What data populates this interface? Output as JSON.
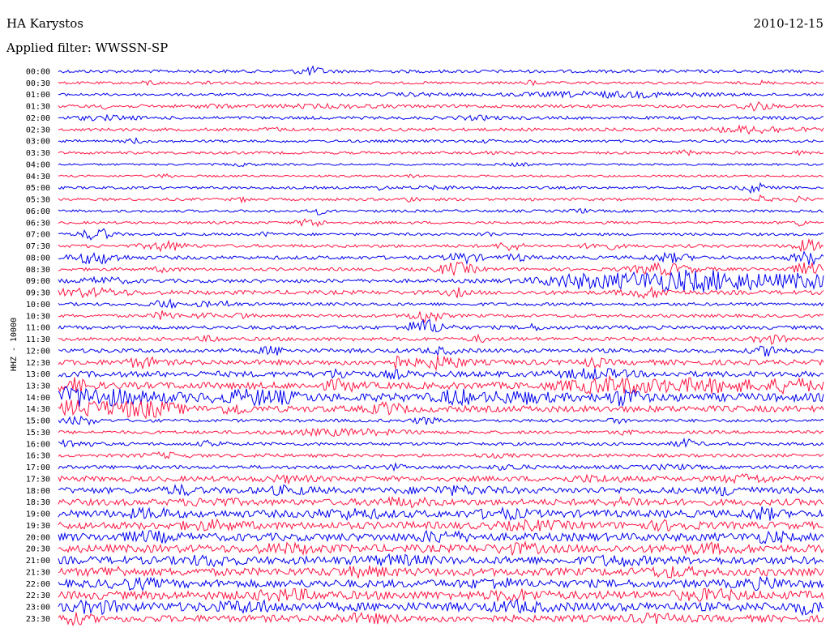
{
  "header": {
    "station": "HA Karystos",
    "date": "2010-12-15",
    "filter": "Applied filter: WWSSN-SP"
  },
  "channel_label": "HHZ - 10000",
  "colors": {
    "odd_trace": "#0000ee",
    "even_trace": "#ff1744"
  },
  "chart_data": {
    "type": "line",
    "title": "HA Karystos",
    "subtitle": "Applied filter: WWSSN-SP",
    "date": "2010-12-15",
    "ylabel": "HHZ - 10000",
    "xlabel": "",
    "grid": false,
    "trace_colors": [
      "#0000ee",
      "#ff1744"
    ],
    "rows": [
      {
        "label": "00:00",
        "base": 0.6,
        "events": [
          [
            0.33,
            1.4,
            1.8
          ]
        ]
      },
      {
        "label": "00:30",
        "base": 0.5,
        "events": [
          [
            0.12,
            0.8,
            1.0
          ],
          [
            0.2,
            1.0,
            0.9
          ],
          [
            0.62,
            0.8,
            1.0
          ],
          [
            0.92,
            0.6,
            1.0
          ]
        ]
      },
      {
        "label": "01:00",
        "base": 0.5,
        "events": [
          [
            0.72,
            0.9,
            12.0
          ],
          [
            0.47,
            0.4,
            4.0
          ]
        ]
      },
      {
        "label": "01:30",
        "base": 0.6,
        "events": [
          [
            0.06,
            0.6,
            1.0
          ],
          [
            0.2,
            0.5,
            2.0
          ],
          [
            0.35,
            0.4,
            8.0
          ],
          [
            0.91,
            1.6,
            2.0
          ]
        ]
      },
      {
        "label": "02:00",
        "base": 0.6,
        "events": [
          [
            0.06,
            0.6,
            4.0
          ],
          [
            0.55,
            0.5,
            3.0
          ]
        ]
      },
      {
        "label": "02:30",
        "base": 0.6,
        "events": [
          [
            0.28,
            0.6,
            1.0
          ],
          [
            0.91,
            1.2,
            5.0
          ]
        ]
      },
      {
        "label": "03:00",
        "base": 0.5,
        "events": [
          [
            0.1,
            1.0,
            1.0
          ],
          [
            0.56,
            0.4,
            1.0
          ]
        ]
      },
      {
        "label": "03:30",
        "base": 0.5,
        "events": [
          [
            0.56,
            0.6,
            1.0
          ],
          [
            0.82,
            0.8,
            1.0
          ],
          [
            0.97,
            0.5,
            1.0
          ]
        ]
      },
      {
        "label": "04:00",
        "base": 0.4,
        "events": [
          [
            0.24,
            0.4,
            2.0
          ],
          [
            0.6,
            0.4,
            2.0
          ]
        ]
      },
      {
        "label": "04:30",
        "base": 0.4,
        "events": [
          [
            0.14,
            0.6,
            1.0
          ],
          [
            0.46,
            0.4,
            1.0
          ]
        ]
      },
      {
        "label": "05:00",
        "base": 0.5,
        "events": [
          [
            0.42,
            0.6,
            1.0
          ],
          [
            0.5,
            0.4,
            4.0
          ],
          [
            0.91,
            1.8,
            1.5
          ]
        ]
      },
      {
        "label": "05:30",
        "base": 0.5,
        "events": [
          [
            0.24,
            0.6,
            1.0
          ],
          [
            0.46,
            0.8,
            1.0
          ],
          [
            0.92,
            1.2,
            1.0
          ],
          [
            0.97,
            0.8,
            1.0
          ]
        ]
      },
      {
        "label": "06:00",
        "base": 0.5,
        "events": [
          [
            0.34,
            1.0,
            1.0
          ],
          [
            0.68,
            0.8,
            1.0
          ]
        ]
      },
      {
        "label": "06:30",
        "base": 0.5,
        "events": [
          [
            0.33,
            1.6,
            1.5
          ],
          [
            0.97,
            1.0,
            1.0
          ]
        ]
      },
      {
        "label": "07:00",
        "base": 0.5,
        "events": [
          [
            0.05,
            2.2,
            2.0
          ],
          [
            0.27,
            0.6,
            1.0
          ],
          [
            0.56,
            0.8,
            1.0
          ]
        ]
      },
      {
        "label": "07:30",
        "base": 0.6,
        "events": [
          [
            0.14,
            1.6,
            2.5
          ],
          [
            0.59,
            1.6,
            1.5
          ],
          [
            0.71,
            1.4,
            2.0
          ],
          [
            0.98,
            2.0,
            2.0
          ]
        ]
      },
      {
        "label": "08:00",
        "base": 0.7,
        "events": [
          [
            0.05,
            2.0,
            3.0
          ],
          [
            0.53,
            1.8,
            2.0
          ],
          [
            0.6,
            1.0,
            1.5
          ],
          [
            0.8,
            1.4,
            2.5
          ],
          [
            0.98,
            2.2,
            2.0
          ]
        ]
      },
      {
        "label": "08:30",
        "base": 0.6,
        "events": [
          [
            0.14,
            0.8,
            1.5
          ],
          [
            0.52,
            2.2,
            2.5
          ],
          [
            0.79,
            2.0,
            4.0
          ],
          [
            0.98,
            2.2,
            2.0
          ]
        ]
      },
      {
        "label": "09:00",
        "base": 0.7,
        "events": [
          [
            0.06,
            1.0,
            3.0
          ],
          [
            0.67,
            1.2,
            4.0
          ],
          [
            0.78,
            2.6,
            12.0
          ],
          [
            0.88,
            2.0,
            10.0
          ],
          [
            0.98,
            1.6,
            3.0
          ]
        ]
      },
      {
        "label": "09:30",
        "base": 0.8,
        "events": [
          [
            0.04,
            1.2,
            5.0
          ],
          [
            0.52,
            1.4,
            1.0
          ],
          [
            0.77,
            1.6,
            3.0
          ]
        ]
      },
      {
        "label": "10:00",
        "base": 0.6,
        "events": [
          [
            0.14,
            1.6,
            1.5
          ],
          [
            0.19,
            0.8,
            1.0
          ],
          [
            0.22,
            1.0,
            1.0
          ]
        ]
      },
      {
        "label": "10:30",
        "base": 0.6,
        "events": [
          [
            0.14,
            1.6,
            1.5
          ],
          [
            0.19,
            0.8,
            1.5
          ],
          [
            0.24,
            1.2,
            1.0
          ],
          [
            0.48,
            2.2,
            2.0
          ]
        ]
      },
      {
        "label": "11:00",
        "base": 0.7,
        "events": [
          [
            0.48,
            2.6,
            2.5
          ],
          [
            0.62,
            0.8,
            1.5
          ]
        ]
      },
      {
        "label": "11:30",
        "base": 0.7,
        "events": [
          [
            0.2,
            0.8,
            1.5
          ],
          [
            0.55,
            1.0,
            1.0
          ],
          [
            0.93,
            1.4,
            2.0
          ]
        ]
      },
      {
        "label": "12:00",
        "base": 0.8,
        "events": [
          [
            0.28,
            1.4,
            1.5
          ],
          [
            0.5,
            1.0,
            2.0
          ],
          [
            0.93,
            1.6,
            2.0
          ]
        ]
      },
      {
        "label": "12:30",
        "base": 1.0,
        "events": [
          [
            0.11,
            1.6,
            2.0
          ],
          [
            0.44,
            2.0,
            1.5
          ],
          [
            0.5,
            2.0,
            3.0
          ],
          [
            0.7,
            1.2,
            1.5
          ]
        ]
      },
      {
        "label": "13:00",
        "base": 1.1,
        "events": [
          [
            0.37,
            1.2,
            2.0
          ],
          [
            0.44,
            1.0,
            1.5
          ],
          [
            0.7,
            1.4,
            4.0
          ]
        ]
      },
      {
        "label": "13:30",
        "base": 1.3,
        "events": [
          [
            0.02,
            2.0,
            2.0
          ],
          [
            0.37,
            1.6,
            2.0
          ],
          [
            0.72,
            2.2,
            6.0
          ],
          [
            0.85,
            1.8,
            8.0
          ],
          [
            0.96,
            1.8,
            3.0
          ]
        ]
      },
      {
        "label": "14:00",
        "base": 1.6,
        "events": [
          [
            0.02,
            2.6,
            10.0
          ],
          [
            0.26,
            2.0,
            5.0
          ],
          [
            0.52,
            2.2,
            2.0
          ],
          [
            0.74,
            2.4,
            2.0
          ],
          [
            0.6,
            1.4,
            4.0
          ]
        ]
      },
      {
        "label": "14:30",
        "base": 1.2,
        "events": [
          [
            0.02,
            2.4,
            8.0
          ],
          [
            0.12,
            2.0,
            4.0
          ],
          [
            0.23,
            1.8,
            1.5
          ],
          [
            0.43,
            1.8,
            2.0
          ]
        ]
      },
      {
        "label": "15:00",
        "base": 0.6,
        "events": [
          [
            0.03,
            1.4,
            2.0
          ],
          [
            0.48,
            1.2,
            1.5
          ],
          [
            0.73,
            0.8,
            1.0
          ]
        ]
      },
      {
        "label": "15:30",
        "base": 0.6,
        "events": [
          [
            0.37,
            1.0,
            8.0
          ],
          [
            0.74,
            0.8,
            1.0
          ]
        ]
      },
      {
        "label": "16:00",
        "base": 0.6,
        "events": [
          [
            0.02,
            1.4,
            2.0
          ],
          [
            0.2,
            1.0,
            1.5
          ],
          [
            0.82,
            1.4,
            1.5
          ]
        ]
      },
      {
        "label": "16:30",
        "base": 0.6,
        "events": [
          [
            0.14,
            0.8,
            3.0
          ],
          [
            0.27,
            0.6,
            1.0
          ],
          [
            0.57,
            0.4,
            3.0
          ]
        ]
      },
      {
        "label": "17:00",
        "base": 0.7,
        "events": [
          [
            0.44,
            0.8,
            1.0
          ],
          [
            0.59,
            0.8,
            2.0
          ],
          [
            0.8,
            0.6,
            3.0
          ]
        ]
      },
      {
        "label": "17:30",
        "base": 1.0,
        "events": [
          [
            0.3,
            0.8,
            3.0
          ],
          [
            0.7,
            0.8,
            4.0
          ],
          [
            0.9,
            1.2,
            3.0
          ]
        ]
      },
      {
        "label": "18:00",
        "base": 1.2,
        "events": [
          [
            0.16,
            1.2,
            2.0
          ],
          [
            0.3,
            1.0,
            3.0
          ],
          [
            0.52,
            1.0,
            5.0
          ],
          [
            0.88,
            1.4,
            2.0
          ]
        ]
      },
      {
        "label": "18:30",
        "base": 1.2,
        "events": [
          [
            0.2,
            1.0,
            3.0
          ],
          [
            0.45,
            1.0,
            4.0
          ],
          [
            0.75,
            1.0,
            3.0
          ]
        ]
      },
      {
        "label": "19:00",
        "base": 1.4,
        "events": [
          [
            0.12,
            1.2,
            3.0
          ],
          [
            0.38,
            1.0,
            5.0
          ],
          [
            0.58,
            1.2,
            3.0
          ],
          [
            0.92,
            1.6,
            2.0
          ]
        ]
      },
      {
        "label": "19:30",
        "base": 1.4,
        "events": [
          [
            0.2,
            1.0,
            4.0
          ],
          [
            0.62,
            1.0,
            4.0
          ],
          [
            0.8,
            1.0,
            3.0
          ]
        ]
      },
      {
        "label": "20:00",
        "base": 1.5,
        "events": [
          [
            0.12,
            1.2,
            3.0
          ],
          [
            0.5,
            1.4,
            3.0
          ],
          [
            0.93,
            1.4,
            2.0
          ]
        ]
      },
      {
        "label": "20:30",
        "base": 1.5,
        "events": [
          [
            0.3,
            1.0,
            4.0
          ],
          [
            0.6,
            1.2,
            3.0
          ],
          [
            0.85,
            1.0,
            4.0
          ]
        ]
      },
      {
        "label": "21:00",
        "base": 1.5,
        "events": [
          [
            0.2,
            1.2,
            3.0
          ],
          [
            0.44,
            1.0,
            4.0
          ],
          [
            0.73,
            1.2,
            3.0
          ]
        ]
      },
      {
        "label": "21:30",
        "base": 1.5,
        "events": [
          [
            0.07,
            1.2,
            2.0
          ],
          [
            0.4,
            1.0,
            4.0
          ],
          [
            0.8,
            1.2,
            3.0
          ]
        ]
      },
      {
        "label": "22:00",
        "base": 1.5,
        "events": [
          [
            0.1,
            1.2,
            3.0
          ],
          [
            0.57,
            1.2,
            3.0
          ],
          [
            0.92,
            1.2,
            3.0
          ]
        ]
      },
      {
        "label": "22:30",
        "base": 1.6,
        "events": [
          [
            0.3,
            1.2,
            4.0
          ],
          [
            0.6,
            1.2,
            3.0
          ],
          [
            0.85,
            1.2,
            4.0
          ]
        ]
      },
      {
        "label": "23:00",
        "base": 1.7,
        "events": [
          [
            0.05,
            1.4,
            3.0
          ],
          [
            0.25,
            1.2,
            4.0
          ],
          [
            0.6,
            1.2,
            3.0
          ],
          [
            0.98,
            1.6,
            2.0
          ]
        ]
      },
      {
        "label": "23:30",
        "base": 1.3,
        "events": [
          [
            0.02,
            1.4,
            2.0
          ],
          [
            0.4,
            1.0,
            4.0
          ],
          [
            0.78,
            1.0,
            3.0
          ]
        ]
      }
    ]
  }
}
